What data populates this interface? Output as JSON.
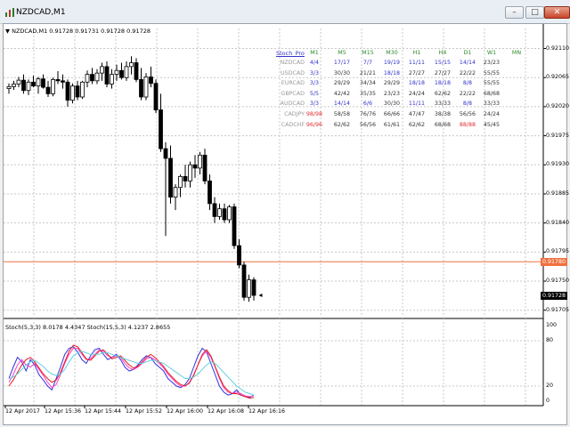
{
  "window": {
    "title": "NZDCAD,M1",
    "min_label": "–",
    "max_label": "□",
    "close_label": "✕"
  },
  "chart": {
    "header": "NZDCAD,M1  0.91728 0.91731 0.91728 0.91728",
    "price_ticks": [
      "0.92110",
      "0.92065",
      "0.92020",
      "0.91975",
      "0.91930",
      "0.91885",
      "0.91840",
      "0.91795",
      "0.91750",
      "0.91705"
    ],
    "ask_line": {
      "label": "0.91780",
      "color": "#f07040"
    },
    "current_price": {
      "label": "0.91728"
    },
    "time_labels": [
      "12 Apr 2017",
      "12 Apr 15:36",
      "12 Apr 15:44",
      "12 Apr 15:52",
      "12 Apr 16:00",
      "12 Apr 16:08",
      "12 Apr 16:16"
    ],
    "stoch_panel": {
      "header": "Stoch(5,3,3) 8.0178 4.4347   Stoch(15,5,3) 4.1237 2.8655",
      "ticks": [
        "100",
        "80",
        "20",
        "0"
      ]
    }
  },
  "stoch_table": {
    "title": "Stoch_Pro",
    "columns": [
      "M1",
      "M5",
      "M15",
      "M30",
      "H1",
      "H4",
      "D1",
      "W1",
      "MN"
    ],
    "rows": [
      {
        "name": "NZDCAD",
        "name_color": "#999999",
        "cells": [
          [
            "4/4",
            "#3333cc"
          ],
          [
            "17/17",
            "#3333cc"
          ],
          [
            "7/7",
            "#3333cc"
          ],
          [
            "19/19",
            "#3333cc"
          ],
          [
            "11/11",
            "#3333cc"
          ],
          [
            "15/15",
            "#3333cc"
          ],
          [
            "14/14",
            "#3333cc"
          ],
          [
            "23/23",
            "#333333"
          ]
        ]
      },
      {
        "name": "USDCAD",
        "name_color": "#999999",
        "cells": [
          [
            "3/3",
            "#3333cc"
          ],
          [
            "30/30",
            "#333333"
          ],
          [
            "21/21",
            "#333333"
          ],
          [
            "18/18",
            "#3333cc"
          ],
          [
            "27/27",
            "#333333"
          ],
          [
            "27/27",
            "#333333"
          ],
          [
            "22/22",
            "#333333"
          ],
          [
            "55/55",
            "#333333"
          ]
        ]
      },
      {
        "name": "EURCAD",
        "name_color": "#999999",
        "cells": [
          [
            "3/3",
            "#3333cc"
          ],
          [
            "29/29",
            "#333333"
          ],
          [
            "34/34",
            "#333333"
          ],
          [
            "29/29",
            "#333333"
          ],
          [
            "18/18",
            "#3333cc"
          ],
          [
            "18/18",
            "#3333cc"
          ],
          [
            "8/8",
            "#3333cc"
          ],
          [
            "55/55",
            "#333333"
          ]
        ]
      },
      {
        "name": "GBPCAD",
        "name_color": "#999999",
        "cells": [
          [
            "5/5",
            "#3333cc"
          ],
          [
            "42/42",
            "#333333"
          ],
          [
            "35/35",
            "#333333"
          ],
          [
            "23/23",
            "#333333"
          ],
          [
            "24/24",
            "#333333"
          ],
          [
            "62/62",
            "#333333"
          ],
          [
            "22/22",
            "#333333"
          ],
          [
            "68/68",
            "#333333"
          ]
        ]
      },
      {
        "name": "AUDCAD",
        "name_color": "#999999",
        "cells": [
          [
            "3/3",
            "#3333cc"
          ],
          [
            "14/14",
            "#3333cc"
          ],
          [
            "6/6",
            "#3333cc"
          ],
          [
            "30/30",
            "#333333"
          ],
          [
            "11/11",
            "#3333cc"
          ],
          [
            "33/33",
            "#333333"
          ],
          [
            "8/8",
            "#3333cc"
          ],
          [
            "33/33",
            "#333333"
          ]
        ]
      },
      {
        "name": "CADJPY",
        "name_color": "#999999",
        "cells": [
          [
            "98/98",
            "#e03030"
          ],
          [
            "58/58",
            "#333333"
          ],
          [
            "76/76",
            "#333333"
          ],
          [
            "66/66",
            "#333333"
          ],
          [
            "47/47",
            "#333333"
          ],
          [
            "38/38",
            "#333333"
          ],
          [
            "56/56",
            "#333333"
          ],
          [
            "24/24",
            "#333333"
          ]
        ]
      },
      {
        "name": "CADCHF",
        "name_color": "#999999",
        "cells": [
          [
            "96/96",
            "#e03030"
          ],
          [
            "62/62",
            "#333333"
          ],
          [
            "56/56",
            "#333333"
          ],
          [
            "61/61",
            "#333333"
          ],
          [
            "62/62",
            "#333333"
          ],
          [
            "68/68",
            "#333333"
          ],
          [
            "88/88",
            "#e03030"
          ],
          [
            "45/45",
            "#333333"
          ]
        ]
      }
    ]
  },
  "candles": [
    [
      0.92048,
      0.92056,
      0.9204,
      0.92051
    ],
    [
      0.92051,
      0.9206,
      0.92046,
      0.92055
    ],
    [
      0.92055,
      0.92066,
      0.9205,
      0.92061
    ],
    [
      0.92061,
      0.9207,
      0.9204,
      0.92045
    ],
    [
      0.92045,
      0.92062,
      0.92038,
      0.92058
    ],
    [
      0.92058,
      0.92068,
      0.9205,
      0.92052
    ],
    [
      0.92052,
      0.92066,
      0.9204,
      0.92063
    ],
    [
      0.92063,
      0.9207,
      0.92048,
      0.9205
    ],
    [
      0.9205,
      0.9206,
      0.92035,
      0.9204
    ],
    [
      0.9204,
      0.92065,
      0.92036,
      0.92062
    ],
    [
      0.92062,
      0.92075,
      0.92055,
      0.9206
    ],
    [
      0.9206,
      0.9207,
      0.92048,
      0.92058
    ],
    [
      0.92058,
      0.92062,
      0.9202,
      0.9203
    ],
    [
      0.9203,
      0.92056,
      0.92025,
      0.92052
    ],
    [
      0.92052,
      0.9206,
      0.9203,
      0.92035
    ],
    [
      0.92035,
      0.9206,
      0.92032,
      0.92058
    ],
    [
      0.92058,
      0.92076,
      0.9205,
      0.9207
    ],
    [
      0.9207,
      0.9208,
      0.92055,
      0.9206
    ],
    [
      0.9206,
      0.92078,
      0.92055,
      0.92072
    ],
    [
      0.92072,
      0.92088,
      0.9206,
      0.92082
    ],
    [
      0.92082,
      0.9209,
      0.9205,
      0.92055
    ],
    [
      0.92055,
      0.92078,
      0.92048,
      0.9207
    ],
    [
      0.9207,
      0.92085,
      0.9206,
      0.92076
    ],
    [
      0.92076,
      0.92088,
      0.92062,
      0.92065
    ],
    [
      0.92065,
      0.9209,
      0.9206,
      0.92082
    ],
    [
      0.92082,
      0.92098,
      0.9207,
      0.92088
    ],
    [
      0.92088,
      0.92095,
      0.92058,
      0.92062
    ],
    [
      0.92062,
      0.9208,
      0.9203,
      0.92035
    ],
    [
      0.92035,
      0.92072,
      0.9203,
      0.92066
    ],
    [
      0.92066,
      0.92082,
      0.9205,
      0.92056
    ],
    [
      0.92056,
      0.92062,
      0.9201,
      0.92015
    ],
    [
      0.92015,
      0.9204,
      0.9195,
      0.91955
    ],
    [
      0.91955,
      0.91965,
      0.9182,
      0.9194
    ],
    [
      0.9194,
      0.9196,
      0.9187,
      0.9188
    ],
    [
      0.9188,
      0.919,
      0.9186,
      0.91895
    ],
    [
      0.91895,
      0.91915,
      0.9188,
      0.91912
    ],
    [
      0.91912,
      0.9193,
      0.91895,
      0.91905
    ],
    [
      0.91905,
      0.91935,
      0.91895,
      0.9193
    ],
    [
      0.9193,
      0.91945,
      0.9191,
      0.91925
    ],
    [
      0.91925,
      0.9195,
      0.91915,
      0.91945
    ],
    [
      0.91945,
      0.91955,
      0.919,
      0.91905
    ],
    [
      0.91905,
      0.91915,
      0.9186,
      0.9187
    ],
    [
      0.9187,
      0.9188,
      0.9184,
      0.9185
    ],
    [
      0.9185,
      0.9187,
      0.91845,
      0.91862
    ],
    [
      0.91862,
      0.9187,
      0.9184,
      0.91845
    ],
    [
      0.91845,
      0.91868,
      0.9184,
      0.91865
    ],
    [
      0.91865,
      0.9187,
      0.918,
      0.91805
    ],
    [
      0.91805,
      0.91815,
      0.9177,
      0.91775
    ],
    [
      0.91775,
      0.9178,
      0.9172,
      0.91725
    ],
    [
      0.91725,
      0.9176,
      0.91718,
      0.91752
    ],
    [
      0.91752,
      0.91756,
      0.9172,
      0.91728
    ]
  ],
  "stoch_series": [
    {
      "name": "Stoch(5,3,3) main",
      "color": "#3030e0",
      "values": [
        30,
        45,
        58,
        52,
        40,
        55,
        48,
        35,
        28,
        20,
        15,
        30,
        45,
        62,
        70,
        72,
        65,
        55,
        50,
        60,
        68,
        70,
        62,
        55,
        58,
        62,
        55,
        45,
        40,
        42,
        48,
        55,
        60,
        58,
        50,
        45,
        40,
        30,
        25,
        20,
        18,
        22,
        30,
        45,
        60,
        70,
        65,
        50,
        35,
        20,
        12,
        8,
        10,
        15,
        8,
        6,
        5,
        8
      ]
    },
    {
      "name": "Stoch(5,3,3) signal",
      "color": "#ff40c0",
      "values": [
        25,
        35,
        48,
        55,
        48,
        45,
        50,
        42,
        34,
        25,
        18,
        22,
        35,
        50,
        62,
        70,
        70,
        62,
        55,
        56,
        62,
        68,
        66,
        60,
        58,
        60,
        58,
        50,
        44,
        42,
        45,
        50,
        56,
        58,
        55,
        50,
        44,
        36,
        30,
        24,
        20,
        20,
        25,
        35,
        48,
        60,
        66,
        58,
        45,
        30,
        18,
        12,
        10,
        12,
        10,
        7,
        6,
        7
      ]
    },
    {
      "name": "Stoch(15,5,3) main",
      "color": "#e02020",
      "values": [
        20,
        28,
        38,
        48,
        55,
        58,
        52,
        44,
        36,
        30,
        25,
        28,
        38,
        52,
        66,
        74,
        72,
        64,
        56,
        54,
        60,
        66,
        68,
        62,
        56,
        58,
        60,
        54,
        48,
        44,
        46,
        52,
        58,
        62,
        58,
        52,
        46,
        38,
        32,
        26,
        22,
        20,
        24,
        34,
        48,
        62,
        68,
        60,
        46,
        32,
        20,
        14,
        10,
        10,
        8,
        6,
        4,
        5
      ]
    },
    {
      "name": "Stoch(15,5,3) signal",
      "color": "#60d0e0",
      "values": [
        30,
        32,
        36,
        42,
        48,
        52,
        54,
        50,
        46,
        40,
        36,
        34,
        36,
        42,
        52,
        60,
        64,
        66,
        64,
        62,
        62,
        62,
        64,
        64,
        62,
        60,
        58,
        56,
        54,
        52,
        50,
        50,
        52,
        54,
        54,
        52,
        50,
        46,
        42,
        38,
        34,
        30,
        30,
        32,
        36,
        42,
        48,
        52,
        50,
        44,
        38,
        32,
        26,
        20,
        16,
        12,
        10,
        8
      ]
    }
  ]
}
